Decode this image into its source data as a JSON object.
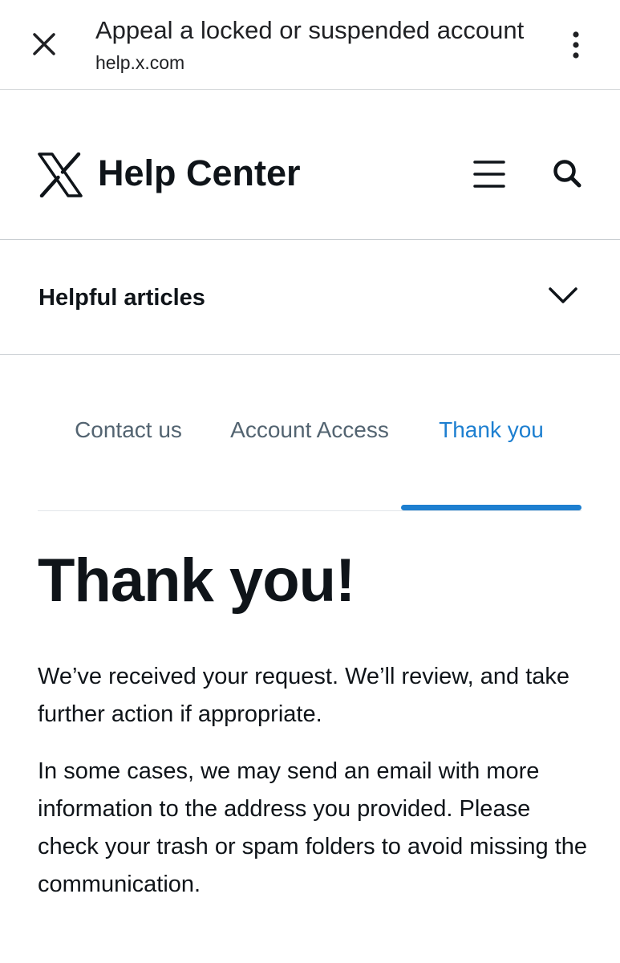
{
  "browser": {
    "title": "Appeal a locked or suspended account",
    "url": "help.x.com"
  },
  "header": {
    "title": "Help Center",
    "icons": [
      "x-logo",
      "hamburger-menu-icon",
      "search-icon"
    ]
  },
  "helpful_articles": {
    "label": "Helpful articles"
  },
  "tabs": [
    {
      "label": "Contact us",
      "active": false
    },
    {
      "label": "Account Access",
      "active": false
    },
    {
      "label": "Thank you",
      "active": true
    }
  ],
  "content": {
    "heading": "Thank you!",
    "paragraphs": [
      "We’ve received your request. We’ll review, and take further action if appropriate.",
      "In some cases, we may send an email with more information to the address you provided. Please check your trash or spam folders to avoid missing the communication."
    ]
  },
  "colors": {
    "accent": "#1d7fd0",
    "text": "#0f1419",
    "muted": "#536471"
  }
}
